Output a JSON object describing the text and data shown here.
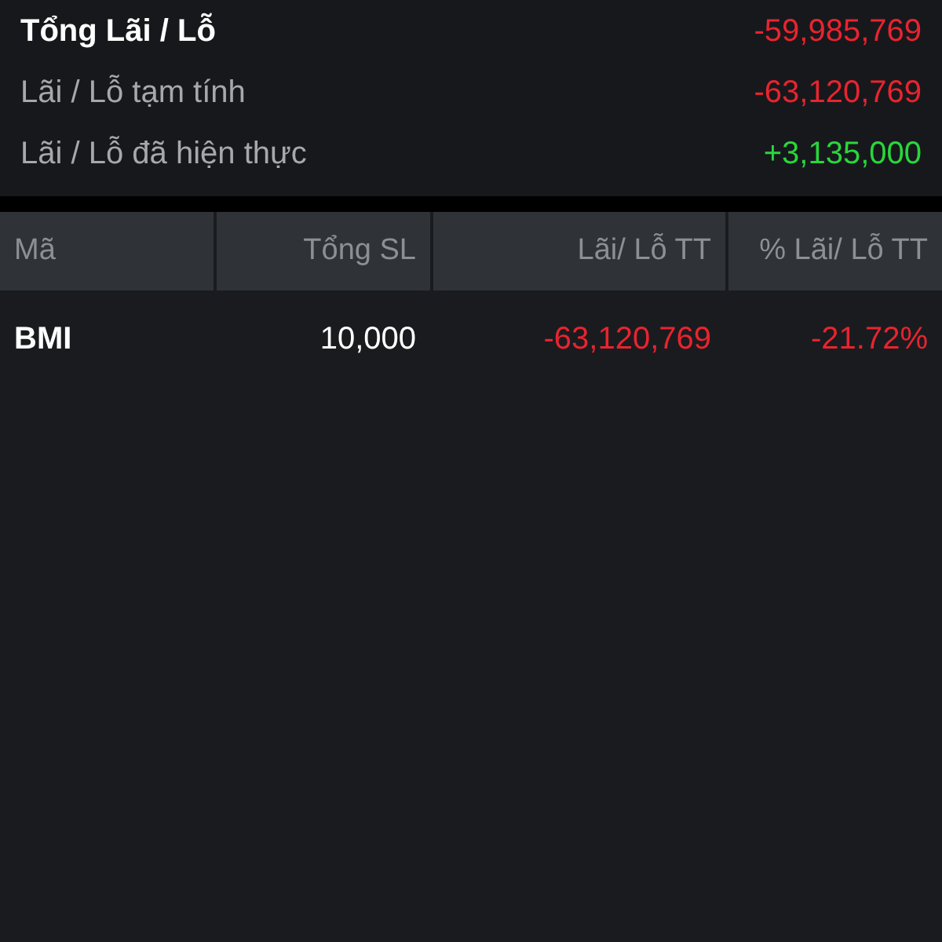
{
  "summary": [
    {
      "label": "Tổng Lãi / Lỗ",
      "value": "-59,985,769",
      "kind": "loss",
      "emphasis": true
    },
    {
      "label": "Lãi / Lỗ tạm tính",
      "value": "-63,120,769",
      "kind": "loss",
      "emphasis": false
    },
    {
      "label": "Lãi / Lỗ đã hiện thực",
      "value": "+3,135,000",
      "kind": "gain",
      "emphasis": false
    }
  ],
  "table": {
    "columns": [
      "Mã",
      "Tổng SL",
      "Lãi/ Lỗ TT",
      "% Lãi/ Lỗ TT"
    ],
    "rows": [
      {
        "symbol": "BMI",
        "quantity": "10,000",
        "pnl": "-63,120,769",
        "pnl_percent": "-21.72%",
        "kind": "loss"
      }
    ]
  }
}
